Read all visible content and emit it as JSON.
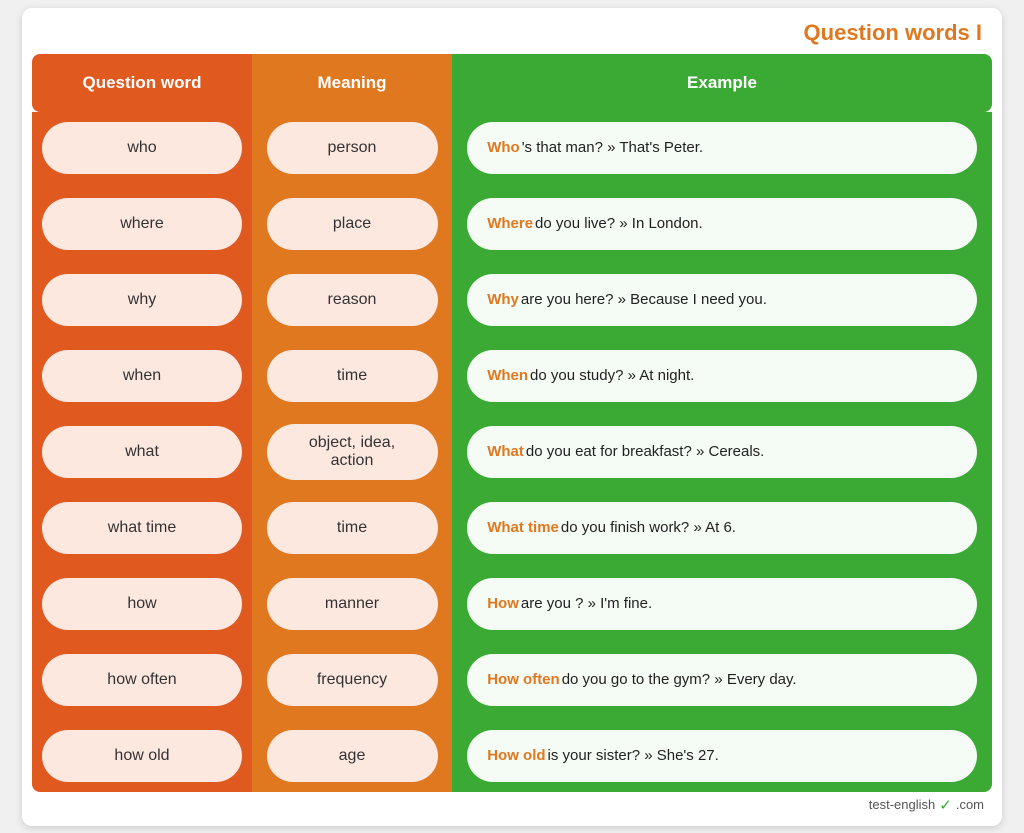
{
  "title": "Question words I",
  "footer": "test-english",
  "footer_domain": ".com",
  "columns": {
    "question_header": "Question word",
    "meaning_header": "Meaning",
    "example_header": "Example"
  },
  "rows": [
    {
      "word": "who",
      "meaning": "person",
      "highlight": "Who",
      "example_rest": "'s that man? » That's Peter."
    },
    {
      "word": "where",
      "meaning": "place",
      "highlight": "Where",
      "example_rest": " do you live? » In London."
    },
    {
      "word": "why",
      "meaning": "reason",
      "highlight": "Why",
      "example_rest": " are you here? » Because I need you."
    },
    {
      "word": "when",
      "meaning": "time",
      "highlight": "When",
      "example_rest": " do you study? » At night."
    },
    {
      "word": "what",
      "meaning": "object, idea,\naction",
      "highlight": "What",
      "example_rest": " do you eat for breakfast? » Cereals."
    },
    {
      "word": "what time",
      "meaning": "time",
      "highlight": "What time",
      "example_rest": " do you finish work? » At 6."
    },
    {
      "word": "how",
      "meaning": "manner",
      "highlight": "How",
      "example_rest": " are you ? » I'm fine."
    },
    {
      "word": "how often",
      "meaning": "frequency",
      "highlight": "How often",
      "example_rest": " do you go to the gym? » Every day."
    },
    {
      "word": "how old",
      "meaning": "age",
      "highlight": "How old",
      "example_rest": " is your sister? » She's 27."
    }
  ]
}
